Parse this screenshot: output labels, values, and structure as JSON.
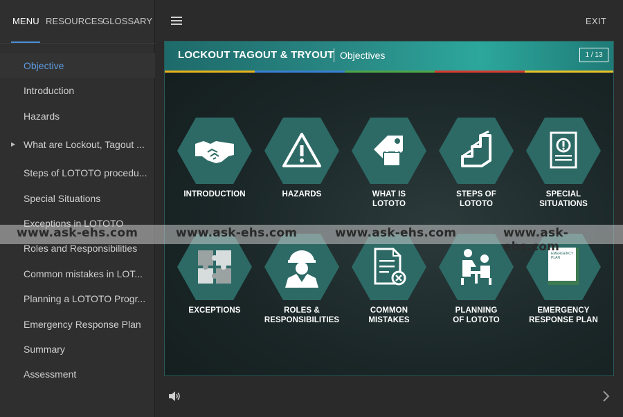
{
  "sidebar": {
    "tabs": [
      {
        "label": "MENU"
      },
      {
        "label": "RESOURCES"
      },
      {
        "label": "GLOSSARY"
      }
    ],
    "items": [
      {
        "label": "Objective"
      },
      {
        "label": "Introduction"
      },
      {
        "label": "Hazards"
      },
      {
        "label": "What are Lockout, Tagout ..."
      },
      {
        "label": "Steps of LOTOTO procedu..."
      },
      {
        "label": "Special Situations"
      },
      {
        "label": "Exceptions in LOTOTO"
      },
      {
        "label": "Roles and Responsibilities"
      },
      {
        "label": "Common mistakes in LOT..."
      },
      {
        "label": "Planning a LOTOTO Progr..."
      },
      {
        "label": "Emergency Response Plan"
      },
      {
        "label": "Summary"
      },
      {
        "label": "Assessment"
      }
    ]
  },
  "topbar": {
    "exit_label": "EXIT"
  },
  "slide": {
    "title": "LOCKOUT TAGOUT & TRYOUT",
    "subtitle": "Objectives",
    "page": "1 / 13",
    "stripe_colors": [
      "#e8b31c",
      "#3a7fd1",
      "#4ea54a",
      "#d83a30",
      "#e8c22a"
    ],
    "hex_color": "#2d6a66",
    "tiles": [
      {
        "label": "INTRODUCTION",
        "icon": "handshake-icon"
      },
      {
        "label": "HAZARDS",
        "icon": "warning-icon"
      },
      {
        "label": "WHAT IS\nLOTOTO",
        "icon": "lock-tag-icon"
      },
      {
        "label": "STEPS OF\nLOTOTO",
        "icon": "steps-icon"
      },
      {
        "label": "SPECIAL\nSITUATIONS",
        "icon": "alert-document-icon"
      },
      {
        "label": "EXCEPTIONS",
        "icon": "puzzle-icon"
      },
      {
        "label": "ROLES &\nRESPONSIBILITIES",
        "icon": "worker-icon"
      },
      {
        "label": "COMMON\nMISTAKES",
        "icon": "document-error-icon"
      },
      {
        "label": "PLANNING\nOF LOTOTO",
        "icon": "meeting-icon"
      },
      {
        "label": "EMERGENCY\nRESPONSE PLAN",
        "icon": "emergency-book-icon",
        "book_text": "EMERGENCY\nPLAN"
      }
    ]
  },
  "watermark": {
    "texts": [
      "www.ask-ehs.com",
      "www.ask-ehs.com",
      "www.ask-ehs.com",
      "www.ask-ehs.com"
    ]
  }
}
